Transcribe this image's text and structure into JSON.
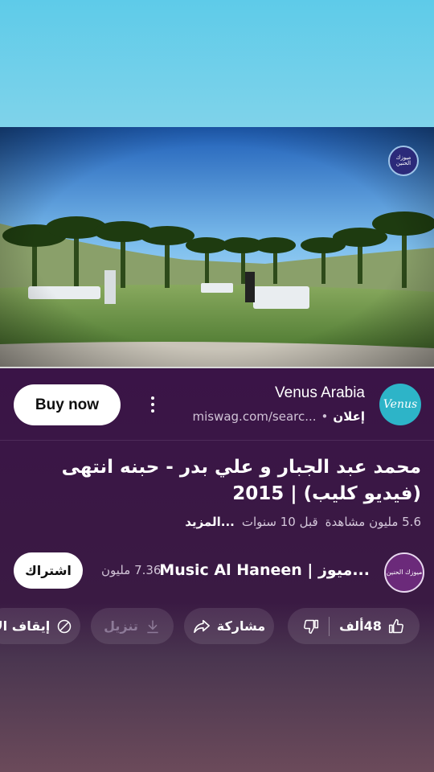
{
  "video": {
    "watermark": "ميوزك الحنين"
  },
  "ad": {
    "title": "Venus Arabia",
    "tag": "إعلان",
    "url": "miswag.com/searc...",
    "logo_text": "Venus",
    "buy_label": "Buy now"
  },
  "title": "محمد عبد الجبار و علي بدر - حبنه انتهى (فيديو كليب) | 2015",
  "meta": {
    "views": "5.6 مليون مشاهدة",
    "age": "قبل 10 سنوات",
    "more": "...المزيد"
  },
  "channel": {
    "name": "Music Al Haneen | ميوز...",
    "subscribers": "7.36 مليون",
    "avatar_text": "ميوزك الحنين",
    "subscribe_label": "اشتراك"
  },
  "actions": {
    "likes": "48ألف",
    "share": "مشاركة",
    "download": "تنزيل",
    "stop_ads": "إيقاف الإ"
  },
  "colors": {
    "background": "#3a1447",
    "top_band": "#5ecbe9",
    "ad_logo": "#2db4c8"
  }
}
